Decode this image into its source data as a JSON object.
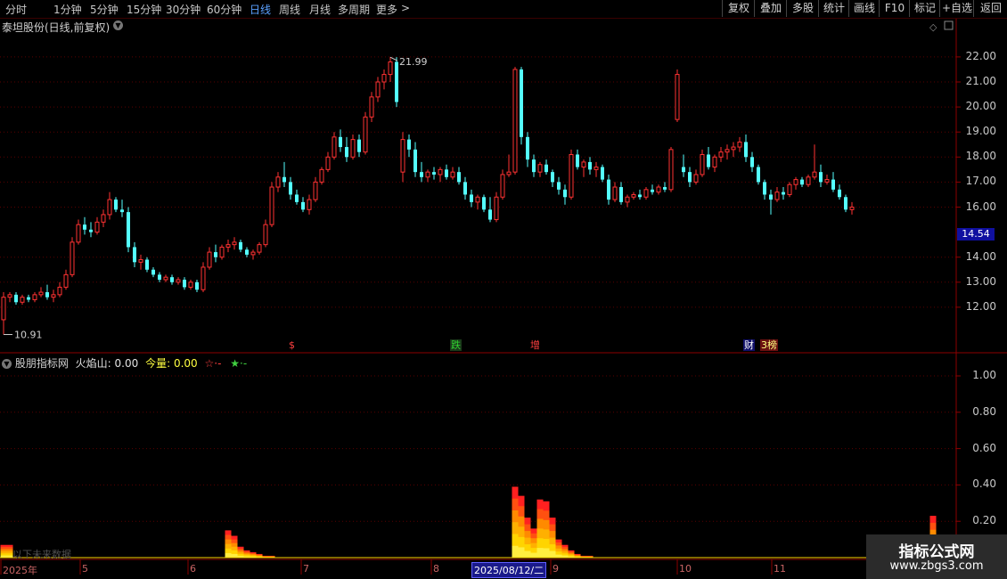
{
  "toolbar": {
    "tabs": [
      "分时",
      "1分钟",
      "5分钟",
      "15分钟",
      "30分钟",
      "60分钟",
      "日线",
      "周线",
      "月线",
      "多周期",
      "更多"
    ],
    "active_tab": "日线",
    "more_arrow": ">",
    "right_buttons": [
      "复权",
      "叠加",
      "多股",
      "统计",
      "画线",
      "F10",
      "标记",
      "+自选",
      "返回"
    ]
  },
  "chart": {
    "title": "泰坦股份(日线,前复权)",
    "price_axis": [
      "22.00",
      "21.00",
      "20.00",
      "19.00",
      "18.00",
      "17.00",
      "16.00",
      "14.00",
      "13.00",
      "12.00"
    ],
    "current_price": "14.54",
    "high_label": "21.99",
    "low_label": "10.91",
    "events": [
      {
        "text": "$",
        "color": "#ff4040",
        "bg": "transparent"
      },
      {
        "text": "跌",
        "color": "#30d030",
        "bg": "#1a3a1a"
      },
      {
        "text": "增",
        "color": "#ff4040",
        "bg": "transparent"
      },
      {
        "text": "财",
        "color": "#ffffff",
        "bg": "#10106a"
      },
      {
        "text": "3榜",
        "color": "#ffff80",
        "bg": "#6a1010"
      }
    ]
  },
  "indicator": {
    "name": "股朋指标网",
    "f1_label": "火焰山:",
    "f1_value": "0.00",
    "f2_label": "今量:",
    "f2_value": "0.00",
    "s1": "☆·-",
    "s2": "★·-",
    "axis": [
      "1.00",
      "0.80",
      "0.60",
      "0.40",
      "0.20"
    ],
    "no_data": "以下未来数据"
  },
  "x_axis": {
    "labels": [
      "2025年",
      "5",
      "6",
      "7",
      "8",
      "9",
      "10",
      "11"
    ],
    "cursor_date": "2025/08/12/二"
  },
  "watermark": {
    "line1": "指标公式网",
    "line2": "www.zbgs3.com"
  },
  "colors": {
    "up": "#ff3232",
    "down": "#54ffff",
    "grid": "#5a0000",
    "border": "#8c0000"
  },
  "chart_data": {
    "type": "candlestick",
    "candles": [
      [
        11.5,
        12.6,
        10.91,
        12.4
      ],
      [
        12.4,
        12.6,
        12.2,
        12.5
      ],
      [
        12.5,
        12.6,
        12.1,
        12.2
      ],
      [
        12.2,
        12.5,
        12.1,
        12.4
      ],
      [
        12.4,
        12.5,
        12.2,
        12.3
      ],
      [
        12.3,
        12.6,
        12.2,
        12.5
      ],
      [
        12.5,
        12.8,
        12.4,
        12.6
      ],
      [
        12.6,
        12.9,
        12.3,
        12.4
      ],
      [
        12.4,
        12.7,
        12.2,
        12.5
      ],
      [
        12.5,
        13.0,
        12.4,
        12.8
      ],
      [
        12.8,
        13.5,
        12.7,
        13.3
      ],
      [
        13.3,
        14.8,
        13.2,
        14.6
      ],
      [
        14.6,
        15.5,
        14.5,
        15.3
      ],
      [
        15.3,
        15.6,
        14.9,
        15.1
      ],
      [
        15.1,
        15.4,
        14.8,
        15.0
      ],
      [
        15.0,
        15.6,
        14.9,
        15.4
      ],
      [
        15.4,
        15.9,
        15.2,
        15.7
      ],
      [
        15.7,
        16.6,
        15.5,
        16.3
      ],
      [
        16.3,
        16.4,
        15.8,
        15.9
      ],
      [
        15.9,
        16.3,
        15.6,
        15.8
      ],
      [
        15.8,
        16.0,
        14.2,
        14.4
      ],
      [
        14.4,
        14.6,
        13.6,
        13.8
      ],
      [
        13.8,
        14.1,
        13.5,
        13.9
      ],
      [
        13.9,
        14.0,
        13.4,
        13.5
      ],
      [
        13.5,
        13.6,
        13.2,
        13.3
      ],
      [
        13.3,
        13.4,
        13.0,
        13.1
      ],
      [
        13.1,
        13.3,
        13.0,
        13.2
      ],
      [
        13.2,
        13.3,
        12.9,
        13.0
      ],
      [
        13.0,
        13.2,
        12.9,
        13.1
      ],
      [
        13.1,
        13.2,
        12.7,
        12.8
      ],
      [
        12.8,
        13.1,
        12.7,
        13.0
      ],
      [
        13.0,
        13.1,
        12.6,
        12.7
      ],
      [
        12.7,
        13.8,
        12.6,
        13.6
      ],
      [
        13.6,
        14.4,
        13.5,
        14.2
      ],
      [
        14.2,
        14.5,
        13.8,
        14.0
      ],
      [
        14.0,
        14.5,
        13.9,
        14.4
      ],
      [
        14.4,
        14.7,
        14.2,
        14.5
      ],
      [
        14.5,
        14.8,
        14.3,
        14.6
      ],
      [
        14.6,
        14.7,
        14.2,
        14.3
      ],
      [
        14.3,
        14.4,
        14.0,
        14.1
      ],
      [
        14.1,
        14.3,
        13.9,
        14.2
      ],
      [
        14.2,
        14.6,
        14.1,
        14.5
      ],
      [
        14.5,
        15.5,
        14.4,
        15.3
      ],
      [
        15.3,
        17.0,
        15.2,
        16.8
      ],
      [
        16.8,
        17.4,
        16.6,
        17.2
      ],
      [
        17.2,
        17.8,
        16.8,
        17.0
      ],
      [
        17.0,
        17.2,
        16.3,
        16.5
      ],
      [
        16.5,
        16.7,
        16.1,
        16.2
      ],
      [
        16.2,
        16.4,
        15.8,
        15.9
      ],
      [
        15.9,
        16.5,
        15.7,
        16.3
      ],
      [
        16.3,
        17.2,
        16.2,
        17.0
      ],
      [
        17.0,
        17.6,
        16.9,
        17.5
      ],
      [
        17.5,
        18.2,
        17.4,
        18.0
      ],
      [
        18.0,
        19.0,
        17.9,
        18.8
      ],
      [
        18.8,
        19.1,
        18.2,
        18.4
      ],
      [
        18.4,
        18.8,
        17.8,
        18.0
      ],
      [
        18.0,
        18.9,
        17.9,
        18.7
      ],
      [
        18.7,
        18.9,
        18.0,
        18.2
      ],
      [
        18.2,
        19.8,
        18.1,
        19.6
      ],
      [
        19.6,
        20.6,
        19.4,
        20.4
      ],
      [
        20.4,
        21.2,
        20.2,
        21.0
      ],
      [
        21.0,
        21.5,
        20.7,
        21.3
      ],
      [
        21.3,
        21.99,
        21.0,
        21.8
      ],
      [
        21.8,
        21.99,
        20.0,
        20.2
      ],
      [
        17.4,
        19.0,
        17.0,
        18.7
      ],
      [
        18.7,
        18.9,
        18.0,
        18.3
      ],
      [
        18.3,
        18.6,
        17.2,
        17.4
      ],
      [
        17.4,
        17.8,
        17.0,
        17.2
      ],
      [
        17.2,
        17.5,
        17.0,
        17.4
      ],
      [
        17.4,
        17.6,
        17.1,
        17.3
      ],
      [
        17.3,
        17.6,
        17.0,
        17.5
      ],
      [
        17.5,
        17.7,
        17.1,
        17.2
      ],
      [
        17.2,
        17.6,
        17.1,
        17.4
      ],
      [
        17.4,
        17.6,
        16.9,
        17.0
      ],
      [
        17.0,
        17.2,
        16.3,
        16.5
      ],
      [
        16.5,
        16.7,
        16.0,
        16.2
      ],
      [
        16.2,
        16.5,
        15.9,
        16.4
      ],
      [
        16.4,
        16.5,
        15.8,
        15.9
      ],
      [
        15.9,
        16.4,
        15.4,
        15.5
      ],
      [
        15.5,
        16.6,
        15.4,
        16.4
      ],
      [
        16.4,
        17.5,
        16.3,
        17.3
      ],
      [
        17.3,
        18.1,
        17.2,
        17.4
      ],
      [
        17.4,
        21.6,
        17.3,
        21.5
      ],
      [
        21.5,
        21.6,
        18.5,
        18.8
      ],
      [
        18.8,
        19.0,
        17.6,
        17.9
      ],
      [
        17.9,
        18.1,
        17.2,
        17.4
      ],
      [
        17.4,
        17.8,
        17.2,
        17.7
      ],
      [
        17.7,
        17.9,
        17.3,
        17.4
      ],
      [
        17.4,
        17.5,
        16.8,
        17.0
      ],
      [
        17.0,
        17.2,
        16.5,
        16.7
      ],
      [
        16.7,
        16.9,
        16.1,
        16.4
      ],
      [
        16.4,
        18.3,
        16.3,
        18.1
      ],
      [
        18.1,
        18.3,
        17.5,
        17.6
      ],
      [
        17.6,
        17.9,
        17.2,
        17.8
      ],
      [
        17.8,
        18.0,
        17.3,
        17.5
      ],
      [
        17.5,
        17.8,
        17.2,
        17.6
      ],
      [
        17.6,
        17.7,
        17.0,
        17.1
      ],
      [
        17.1,
        17.3,
        16.1,
        16.3
      ],
      [
        16.3,
        17.0,
        16.2,
        16.8
      ],
      [
        16.8,
        17.0,
        16.1,
        16.2
      ],
      [
        16.2,
        16.5,
        16.0,
        16.4
      ],
      [
        16.4,
        16.6,
        16.3,
        16.5
      ],
      [
        16.5,
        16.7,
        16.3,
        16.4
      ],
      [
        16.4,
        16.8,
        16.3,
        16.7
      ],
      [
        16.7,
        16.9,
        16.5,
        16.6
      ],
      [
        16.6,
        16.9,
        16.5,
        16.8
      ],
      [
        16.8,
        17.0,
        16.6,
        16.7
      ],
      [
        16.7,
        18.4,
        16.6,
        18.3
      ],
      [
        19.5,
        21.5,
        19.4,
        21.3
      ],
      [
        17.6,
        18.1,
        17.2,
        17.4
      ],
      [
        17.4,
        17.6,
        16.8,
        17.0
      ],
      [
        17.0,
        17.5,
        16.9,
        17.3
      ],
      [
        17.3,
        18.3,
        17.2,
        18.1
      ],
      [
        18.1,
        18.4,
        17.5,
        17.6
      ],
      [
        17.6,
        18.1,
        17.4,
        18.0
      ],
      [
        18.0,
        18.4,
        17.8,
        18.2
      ],
      [
        18.2,
        18.5,
        17.9,
        18.3
      ],
      [
        18.3,
        18.6,
        18.0,
        18.4
      ],
      [
        18.4,
        18.8,
        18.2,
        18.6
      ],
      [
        18.6,
        18.9,
        17.8,
        18.0
      ],
      [
        18.0,
        18.2,
        17.4,
        17.6
      ],
      [
        17.6,
        17.7,
        16.9,
        17.0
      ],
      [
        17.0,
        17.1,
        16.3,
        16.5
      ],
      [
        16.5,
        16.7,
        15.7,
        16.3
      ],
      [
        16.3,
        16.8,
        16.2,
        16.6
      ],
      [
        16.6,
        16.8,
        16.3,
        16.5
      ],
      [
        16.5,
        17.0,
        16.4,
        16.9
      ],
      [
        16.9,
        17.2,
        16.7,
        17.1
      ],
      [
        17.1,
        17.2,
        16.8,
        16.9
      ],
      [
        16.9,
        17.3,
        16.8,
        17.2
      ],
      [
        17.2,
        18.5,
        17.1,
        17.4
      ],
      [
        17.4,
        17.7,
        16.8,
        17.0
      ],
      [
        17.0,
        17.3,
        16.9,
        17.1
      ],
      [
        17.1,
        17.4,
        16.6,
        16.7
      ],
      [
        16.7,
        16.9,
        16.3,
        16.4
      ],
      [
        16.4,
        16.5,
        15.8,
        15.9
      ],
      [
        15.9,
        16.2,
        15.7,
        16.0
      ]
    ],
    "indicator_levels": [
      0.07,
      0.07,
      0,
      0,
      0,
      0,
      0,
      0,
      0,
      0,
      0,
      0,
      0,
      0,
      0,
      0,
      0,
      0,
      0,
      0,
      0,
      0,
      0,
      0,
      0,
      0,
      0,
      0,
      0,
      0,
      0,
      0,
      0,
      0,
      0,
      0,
      0.15,
      0.12,
      0.06,
      0.04,
      0.03,
      0.02,
      0.01,
      0.01,
      0,
      0,
      0,
      0,
      0,
      0,
      0,
      0,
      0,
      0,
      0,
      0,
      0,
      0,
      0,
      0,
      0,
      0,
      0,
      0,
      0,
      0,
      0,
      0,
      0,
      0,
      0,
      0,
      0,
      0,
      0,
      0,
      0,
      0,
      0,
      0,
      0,
      0,
      0.39,
      0.34,
      0.22,
      0.16,
      0.32,
      0.31,
      0.22,
      0.1,
      0.07,
      0.04,
      0.02,
      0.01,
      0.01,
      0,
      0,
      0,
      0,
      0,
      0,
      0,
      0,
      0,
      0,
      0,
      0,
      0,
      0,
      0,
      0,
      0,
      0,
      0,
      0,
      0,
      0,
      0,
      0,
      0,
      0,
      0,
      0,
      0,
      0,
      0,
      0,
      0,
      0,
      0,
      0,
      0,
      0,
      0,
      0,
      0,
      0,
      0,
      0,
      0,
      0,
      0,
      0,
      0,
      0,
      0,
      0,
      0,
      0,
      0.23,
      0.1,
      0
    ],
    "ylim_price": [
      11.0,
      22.5
    ],
    "ylim_indicator": [
      0,
      1.1
    ]
  }
}
